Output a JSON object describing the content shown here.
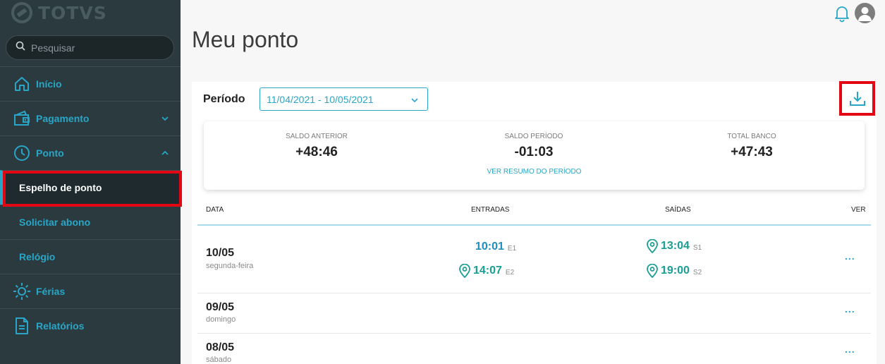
{
  "brand": {
    "name": "TOTVS"
  },
  "search": {
    "placeholder": "Pesquisar"
  },
  "sidebar": {
    "items": [
      {
        "label": "Início"
      },
      {
        "label": "Pagamento"
      },
      {
        "label": "Ponto"
      },
      {
        "label": "Espelho de ponto"
      },
      {
        "label": "Solicitar abono"
      },
      {
        "label": "Relógio"
      },
      {
        "label": "Férias"
      },
      {
        "label": "Relatórios"
      }
    ]
  },
  "page": {
    "title": "Meu ponto"
  },
  "filter": {
    "label": "Período",
    "value": "11/04/2021 - 10/05/2021"
  },
  "summary": {
    "saldo_anterior_label": "SALDO ANTERIOR",
    "saldo_anterior_value": "+48:46",
    "saldo_periodo_label": "SALDO PERÍODO",
    "saldo_periodo_value": "-01:03",
    "total_banco_label": "TOTAL BANCO",
    "total_banco_value": "+47:43",
    "link": "VER RESUMO DO PERÍODO"
  },
  "table": {
    "headers": {
      "data": "DATA",
      "entradas": "ENTRADAS",
      "saidas": "SAÍDAS",
      "ver": "VER"
    },
    "rows": [
      {
        "date": "10/05",
        "weekday": "segunda-feira",
        "e1_time": "10:01",
        "e1_tag": "E1",
        "e2_time": "14:07",
        "e2_tag": "E2",
        "s1_time": "13:04",
        "s1_tag": "S1",
        "s2_time": "19:00",
        "s2_tag": "S2",
        "more": "..."
      },
      {
        "date": "09/05",
        "weekday": "domingo",
        "more": "..."
      },
      {
        "date": "08/05",
        "weekday": "sábado",
        "more": "..."
      }
    ]
  },
  "colors": {
    "accent": "#29a6c7",
    "sidebar": "#2b3a3e",
    "highlight": "#e30613",
    "pin": "#1a9e94"
  }
}
